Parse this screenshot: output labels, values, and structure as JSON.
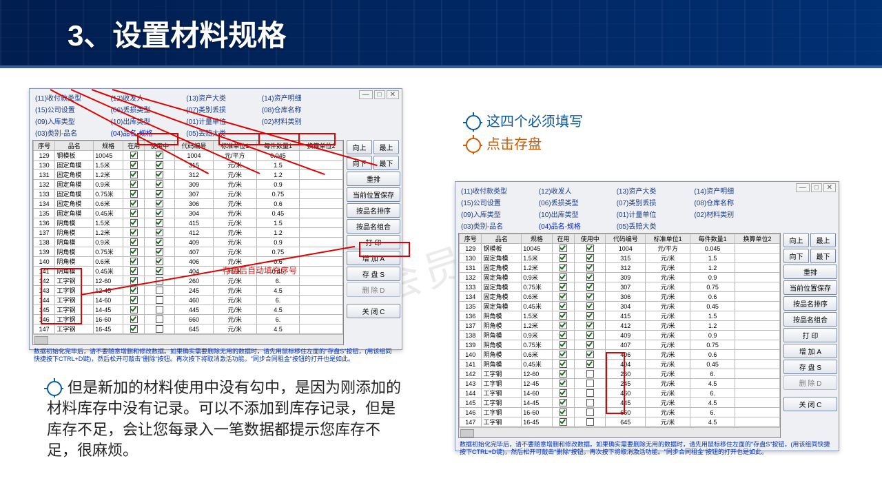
{
  "title": "3、设置材料规格",
  "bullets": {
    "b1": "这四个必须填写",
    "b2": "点击存盘",
    "b3": "但是新加的材料使用中没有勾中，是因为刚添加的材料库存中没有记录。可以不添加到库存记录，但是库存不足，会让您每录入一笔数据都提示您库存不足，很麻烦。"
  },
  "watermark": "非会员水印",
  "annotation": "存盘后自动填充序号",
  "tabs": [
    "(11)收付款类型",
    "(12)收发人",
    "(13)资产大类",
    "(14)资产明细",
    "(15)公司设置",
    "(06)丢损类型",
    "(07)类别丢损",
    "(08)仓库名称",
    "(09)入库类型",
    "(10)出库类型",
    "(01)计量单位",
    "(02)材料类别",
    "(03)类别-品名",
    "(04)品名-规格",
    "(05)丢赔大类"
  ],
  "headers": [
    "序号",
    "品名",
    "规格",
    "在用",
    "使用中",
    "代码编号",
    "标准单位1",
    "每件数量1",
    "换算单位2"
  ],
  "rows1": [
    [
      "129",
      "钢模板",
      "10045",
      "on",
      "on",
      "1004",
      "元/平方",
      "0.045",
      ""
    ],
    [
      "130",
      "固定角模",
      "1.5米",
      "on",
      "on",
      "315",
      "元/米",
      "1.5",
      ""
    ],
    [
      "131",
      "固定角模",
      "1.2米",
      "on",
      "on",
      "312",
      "元/米",
      "1.2",
      ""
    ],
    [
      "132",
      "固定角模",
      "0.9米",
      "on",
      "on",
      "309",
      "元/米",
      "0.9",
      ""
    ],
    [
      "133",
      "固定角模",
      "0.75米",
      "on",
      "on",
      "307",
      "元/米",
      "0.75",
      ""
    ],
    [
      "134",
      "固定角模",
      "0.6米",
      "on",
      "on",
      "306",
      "元/米",
      "0.6",
      ""
    ],
    [
      "135",
      "固定角模",
      "0.45米",
      "on",
      "on",
      "304",
      "元/米",
      "0.45",
      ""
    ],
    [
      "136",
      "阴角模",
      "1.5米",
      "on",
      "on",
      "415",
      "元/米",
      "1.5",
      ""
    ],
    [
      "137",
      "阴角模",
      "1.2米",
      "on",
      "on",
      "412",
      "元/米",
      "1.2",
      ""
    ],
    [
      "138",
      "阴角模",
      "0.9米",
      "on",
      "on",
      "409",
      "元/米",
      "0.9",
      ""
    ],
    [
      "139",
      "阴角模",
      "0.75米",
      "on",
      "on",
      "407",
      "元/米",
      "0.75",
      ""
    ],
    [
      "140",
      "阴角模",
      "0.6米",
      "on",
      "on",
      "406",
      "元/米",
      "0.6",
      ""
    ],
    [
      "141",
      "阴角模",
      "0.45米",
      "on",
      "on",
      "404",
      "元/米",
      "0.45",
      ""
    ],
    [
      "142",
      "工字钢",
      "12-60",
      "on",
      "off",
      "260",
      "元/米",
      "6.",
      ""
    ],
    [
      "143",
      "工字钢",
      "12-45",
      "on",
      "off",
      "245",
      "元/米",
      "4.5",
      ""
    ],
    [
      "144",
      "工字钢",
      "14-60",
      "on",
      "off",
      "460",
      "元/米",
      "6.",
      ""
    ],
    [
      "145",
      "工字钢",
      "14-45",
      "on",
      "off",
      "445",
      "元/米",
      "4.5",
      ""
    ],
    [
      "146",
      "工字钢",
      "16-60",
      "on",
      "off",
      "660",
      "元/米",
      "6.",
      ""
    ],
    [
      "147",
      "工字钢",
      "16-45",
      "on",
      "off",
      "645",
      "元/米",
      "4.5",
      ""
    ]
  ],
  "rows2": [
    [
      "129",
      "钢模板",
      "10045",
      "on",
      "on",
      "1004",
      "元/平方",
      "0.045",
      ""
    ],
    [
      "130",
      "固定角模",
      "1.5米",
      "on",
      "on",
      "315",
      "元/米",
      "1.5",
      ""
    ],
    [
      "131",
      "固定角模",
      "1.2米",
      "on",
      "on",
      "312",
      "元/米",
      "1.2",
      ""
    ],
    [
      "132",
      "固定角模",
      "0.9米",
      "on",
      "on",
      "309",
      "元/米",
      "0.9",
      ""
    ],
    [
      "133",
      "固定角模",
      "0.75米",
      "on",
      "on",
      "307",
      "元/米",
      "0.75",
      ""
    ],
    [
      "134",
      "固定角模",
      "0.6米",
      "on",
      "on",
      "306",
      "元/米",
      "0.6",
      ""
    ],
    [
      "135",
      "固定角模",
      "0.45米",
      "on",
      "on",
      "304",
      "元/米",
      "0.45",
      ""
    ],
    [
      "136",
      "阴角模",
      "1.5米",
      "on",
      "on",
      "415",
      "元/米",
      "1.5",
      ""
    ],
    [
      "137",
      "阴角模",
      "1.2米",
      "on",
      "on",
      "412",
      "元/米",
      "1.2",
      ""
    ],
    [
      "138",
      "阴角模",
      "0.9米",
      "on",
      "on",
      "409",
      "元/米",
      "0.9",
      ""
    ],
    [
      "139",
      "阴角模",
      "0.75米",
      "on",
      "on",
      "407",
      "元/米",
      "0.75",
      ""
    ],
    [
      "140",
      "阴角模",
      "0.6米",
      "on",
      "on",
      "406",
      "元/米",
      "0.6",
      ""
    ],
    [
      "141",
      "阴角模",
      "0.45米",
      "on",
      "on",
      "404",
      "元/米",
      "0.45",
      ""
    ],
    [
      "142",
      "工字钢",
      "12-60",
      "on",
      "off",
      "260",
      "元/米",
      "6.",
      ""
    ],
    [
      "143",
      "工字钢",
      "12-45",
      "on",
      "off",
      "245",
      "元/米",
      "4.5",
      ""
    ],
    [
      "144",
      "工字钢",
      "14-60",
      "on",
      "off",
      "460",
      "元/米",
      "6.",
      ""
    ],
    [
      "145",
      "工字钢",
      "14-45",
      "on",
      "off",
      "445",
      "元/米",
      "4.5",
      ""
    ],
    [
      "146",
      "工字钢",
      "16-60",
      "on",
      "off",
      "660",
      "元/米",
      "6.",
      ""
    ],
    [
      "147",
      "工字钢",
      "16-45",
      "on",
      "off",
      "645",
      "元/米",
      "4.5",
      ""
    ]
  ],
  "side": {
    "up": "向上",
    "top": "最上",
    "down": "向下",
    "bottom": "最下",
    "resort": "重排",
    "savepos": "当前位置保存",
    "sortname": "按品名排序",
    "groupname": "按品名组合",
    "print": "打 印",
    "add": "增 加 A",
    "save": "存 盘 S",
    "delete": "删 除 D",
    "close": "关 闭 C"
  },
  "footnote": "数据初始化完毕后，请不要随意增删和修改数据。如果确实需要删除无用的数据时，请先用鼠标移住左面的\"存盘S\"按钮，(用该组同快捷按下CTRL+D键)，然后松开可敲击\"删除\"按钮。再次按下将取消激活功能。\"同步合同租金\"按钮的打开也是如此。"
}
